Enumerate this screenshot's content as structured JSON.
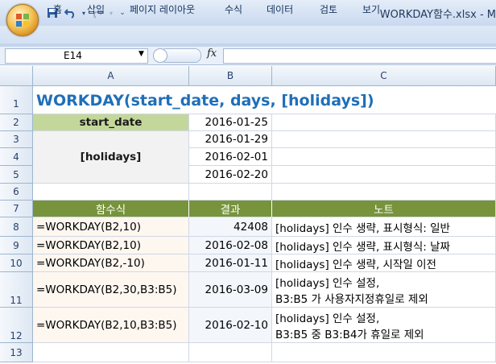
{
  "window": {
    "title": "WORKDAY함수.xlsx - M"
  },
  "icons": [
    "office-logo",
    "save-icon",
    "undo-icon",
    "redo-icon",
    "customize-icon"
  ],
  "ribbon": {
    "tabs": [
      "홈",
      "삽입",
      "페이지 레이아웃",
      "수식",
      "데이터",
      "검토",
      "보기"
    ]
  },
  "formula_bar": {
    "name_box": "E14",
    "fx_label": "fx",
    "formula": ""
  },
  "grid": {
    "columns": [
      "A",
      "B",
      "C"
    ],
    "rows": [
      "1",
      "2",
      "3",
      "4",
      "5",
      "6",
      "7",
      "8",
      "9",
      "10",
      "11",
      "12",
      "13"
    ],
    "title": "WORKDAY(start_date, days, [holidays])",
    "start_date_label": "start_date",
    "holidays_label": "[holidays]",
    "dates": [
      "2016-01-25",
      "2016-01-29",
      "2016-02-01",
      "2016-02-20"
    ],
    "table_headers": [
      "함수식",
      "결과",
      "노트"
    ],
    "table_rows": [
      {
        "formula": "=WORKDAY(B2,10)",
        "result": "42408",
        "note": "[holidays] 인수 생략, 표시형식: 일반"
      },
      {
        "formula": "=WORKDAY(B2,10)",
        "result": "2016-02-08",
        "note": "[holidays] 인수 생략, 표시형식: 날짜"
      },
      {
        "formula": "=WORKDAY(B2,-10)",
        "result": "2016-01-11",
        "note": "[holidays] 인수 생략, 시작일 이전"
      },
      {
        "formula": "=WORKDAY(B2,30,B3:B5)",
        "result": "2016-03-09",
        "note_line1": "[holidays] 인수 설정,",
        "note_line2": "B3:B5 가 사용자지정휴일로 제외"
      },
      {
        "formula": "=WORKDAY(B2,10,B3:B5)",
        "result": "2016-02-10",
        "note_line1": "[holidays] 인수 설정,",
        "note_line2": "B3:B5 중 B3:B4가 휴일로 제외"
      }
    ]
  },
  "colors": {
    "title_text": "#1f6fb8",
    "label_green": "#c4d79b",
    "header_olive": "#77933c",
    "label_gray": "#f2f2f2"
  }
}
